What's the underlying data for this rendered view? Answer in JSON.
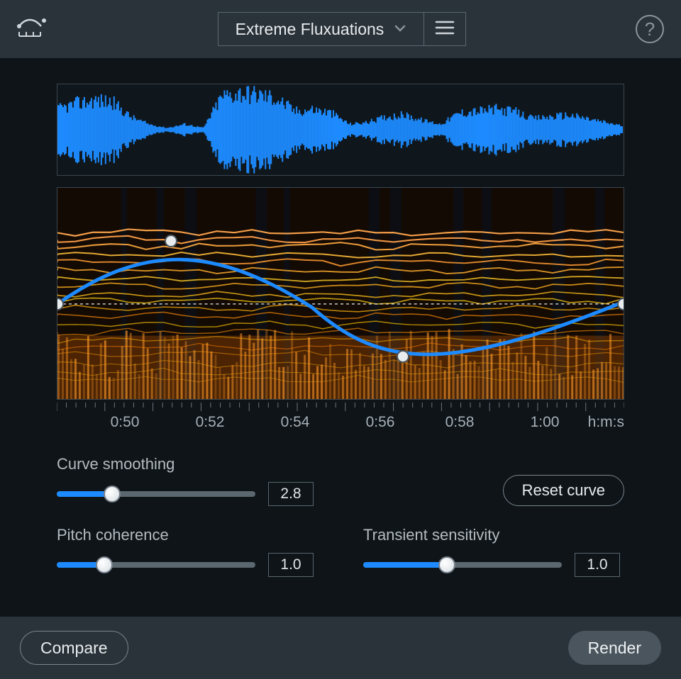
{
  "header": {
    "preset_name": "Extreme Fluxuations"
  },
  "ruler": {
    "ticks": [
      "0:50",
      "0:52",
      "0:54",
      "0:56",
      "0:58",
      "1:00"
    ],
    "unit": "h:m:s"
  },
  "controls": {
    "curve_smoothing": {
      "label": "Curve smoothing",
      "value": "2.8",
      "fill_pct": 28
    },
    "reset_curve_label": "Reset curve",
    "pitch_coherence": {
      "label": "Pitch coherence",
      "value": "1.0",
      "fill_pct": 24
    },
    "transient_sensitivity": {
      "label": "Transient sensitivity",
      "value": "1.0",
      "fill_pct": 42
    }
  },
  "footer": {
    "compare_label": "Compare",
    "render_label": "Render"
  },
  "colors": {
    "accent": "#1d8bff",
    "panel": "#2a333a",
    "bg": "#0e1418"
  },
  "curve": {
    "handles": [
      {
        "x_pct": 0,
        "y_pct": 55
      },
      {
        "x_pct": 20,
        "y_pct": 25
      },
      {
        "x_pct": 61,
        "y_pct": 80
      },
      {
        "x_pct": 100,
        "y_pct": 55
      }
    ]
  }
}
